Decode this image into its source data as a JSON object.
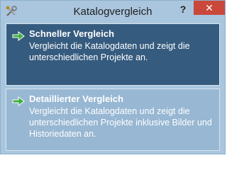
{
  "window": {
    "title": "Katalogvergleich",
    "help_label": "?",
    "close_label": "✕"
  },
  "options": [
    {
      "title": "Schneller Vergleich",
      "description": "Vergleicht die Katalogdaten und zeigt die unterschiedlichen Projekte an."
    },
    {
      "title": "Detaillierter Vergleich",
      "description": "Vergleicht die Katalogdaten und zeigt die unterschiedlichen Projekte inklusive Bilder und Historiedaten an."
    }
  ],
  "colors": {
    "window_bg": "#a9c6de",
    "selected_option_bg": "#355b7f",
    "option_bg": "#97b7d3",
    "close_bg": "#c9483b",
    "arrow_green": "#3fae3f"
  },
  "icons": {
    "app": "tools-icon",
    "option_arrow": "green-arrow-right-icon"
  }
}
